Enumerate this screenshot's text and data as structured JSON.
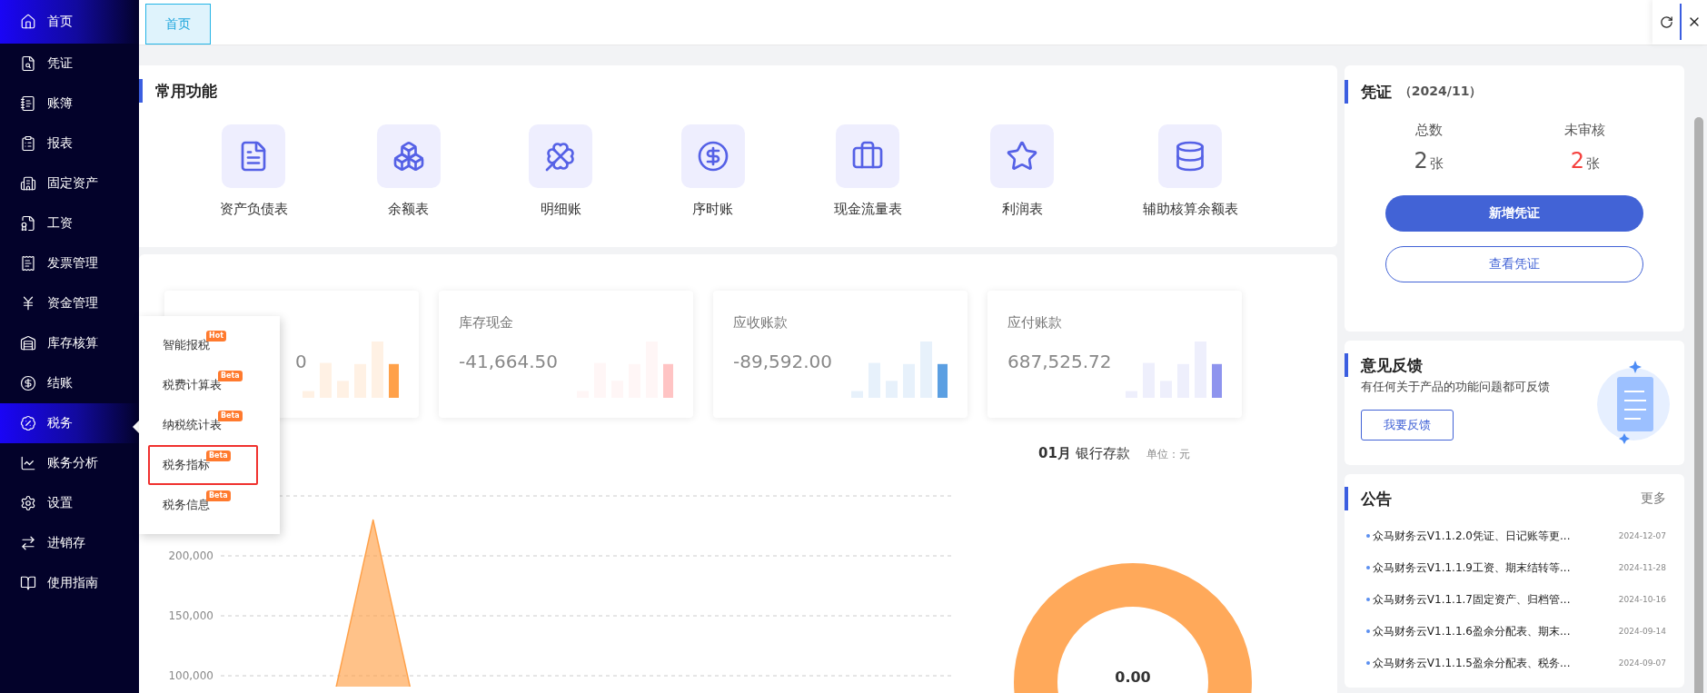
{
  "tabs": [
    {
      "label": "首页",
      "selected": true
    }
  ],
  "sidebar": {
    "items": [
      {
        "label": "首页",
        "selected": true
      },
      {
        "label": "凭证",
        "selected": false
      },
      {
        "label": "账簿",
        "selected": false
      },
      {
        "label": "报表",
        "selected": false
      },
      {
        "label": "固定资产",
        "selected": false
      },
      {
        "label": "工资",
        "selected": false
      },
      {
        "label": "发票管理",
        "selected": false
      },
      {
        "label": "资金管理",
        "selected": false
      },
      {
        "label": "库存核算",
        "selected": false
      },
      {
        "label": "结账",
        "selected": false
      },
      {
        "label": "税务",
        "selected": true
      },
      {
        "label": "账务分析",
        "selected": false
      },
      {
        "label": "设置",
        "selected": false
      },
      {
        "label": "进销存",
        "selected": false
      },
      {
        "label": "使用指南",
        "selected": false
      }
    ]
  },
  "tax_menu": {
    "items": [
      {
        "label": "智能报税",
        "badge": "Hot",
        "selected": false
      },
      {
        "label": "税费计算表",
        "badge": "Beta",
        "selected": false
      },
      {
        "label": "纳税统计表",
        "badge": "Beta",
        "selected": false
      },
      {
        "label": "税务指标",
        "badge": "Beta",
        "selected": true
      },
      {
        "label": "税务信息",
        "badge": "Beta",
        "selected": false
      }
    ]
  },
  "quick_functions": {
    "title": "常用功能",
    "items": [
      {
        "label": "资产负债表"
      },
      {
        "label": "余额表"
      },
      {
        "label": "明细账"
      },
      {
        "label": "序时账"
      },
      {
        "label": "现金流量表"
      },
      {
        "label": "利润表"
      },
      {
        "label": "辅助核算余额表"
      }
    ]
  },
  "stat_cards": [
    {
      "value": "0",
      "color": "#ffa14a"
    },
    {
      "label": "库存现金",
      "value": "-41,664.50",
      "color": "#ffc4c4"
    },
    {
      "label": "应收账款",
      "value": "-89,592.00",
      "color": "#5b9fe2"
    },
    {
      "label": "应付账款",
      "value": "687,525.72",
      "color": "#8e94ee"
    }
  ],
  "line_chart": {
    "chart_data": {
      "type": "area",
      "grid": true,
      "ylim": [
        0,
        250000
      ],
      "yticks": [
        {
          "value": 100000,
          "label": "100,000"
        },
        {
          "value": 150000,
          "label": "150,000"
        },
        {
          "value": 200000,
          "label": "200,000"
        }
      ],
      "series": [
        {
          "color": "#ffa14a",
          "values": [
            0,
            0,
            230000,
            0,
            0,
            0,
            0,
            0,
            0,
            0,
            0,
            0
          ]
        }
      ]
    }
  },
  "bank_chart": {
    "month": "01月",
    "title": "银行存款",
    "unit": "单位：元",
    "center_value": "0.00"
  },
  "voucher_panel": {
    "title": "凭证",
    "period": "（2024/11）",
    "stats": [
      {
        "kind": "total",
        "label": "总数",
        "count": "2",
        "unit": "张"
      },
      {
        "kind": "pending",
        "label": "未审核",
        "count": "2",
        "unit": "张"
      }
    ],
    "buttons": [
      {
        "kind": "primary",
        "label": "新增凭证"
      },
      {
        "kind": "outline",
        "label": "查看凭证"
      }
    ]
  },
  "feedback": {
    "title": "意见反馈",
    "description": "有任何关于产品的功能问题都可反馈",
    "button": "我要反馈"
  },
  "notices": {
    "title": "公告",
    "more": "更多",
    "items": [
      {
        "text": "众马财务云V1.1.2.0凭证、日记账等更...",
        "date": "2024-12-07"
      },
      {
        "text": "众马财务云V1.1.1.9工资、期末结转等...",
        "date": "2024-11-28"
      },
      {
        "text": "众马财务云V1.1.1.7固定资产、归档管...",
        "date": "2024-10-16"
      },
      {
        "text": "众马财务云V1.1.1.6盈余分配表、期末...",
        "date": "2024-09-14"
      },
      {
        "text": "众马财务云V1.1.1.5盈余分配表、税务...",
        "date": "2024-09-07"
      }
    ]
  }
}
